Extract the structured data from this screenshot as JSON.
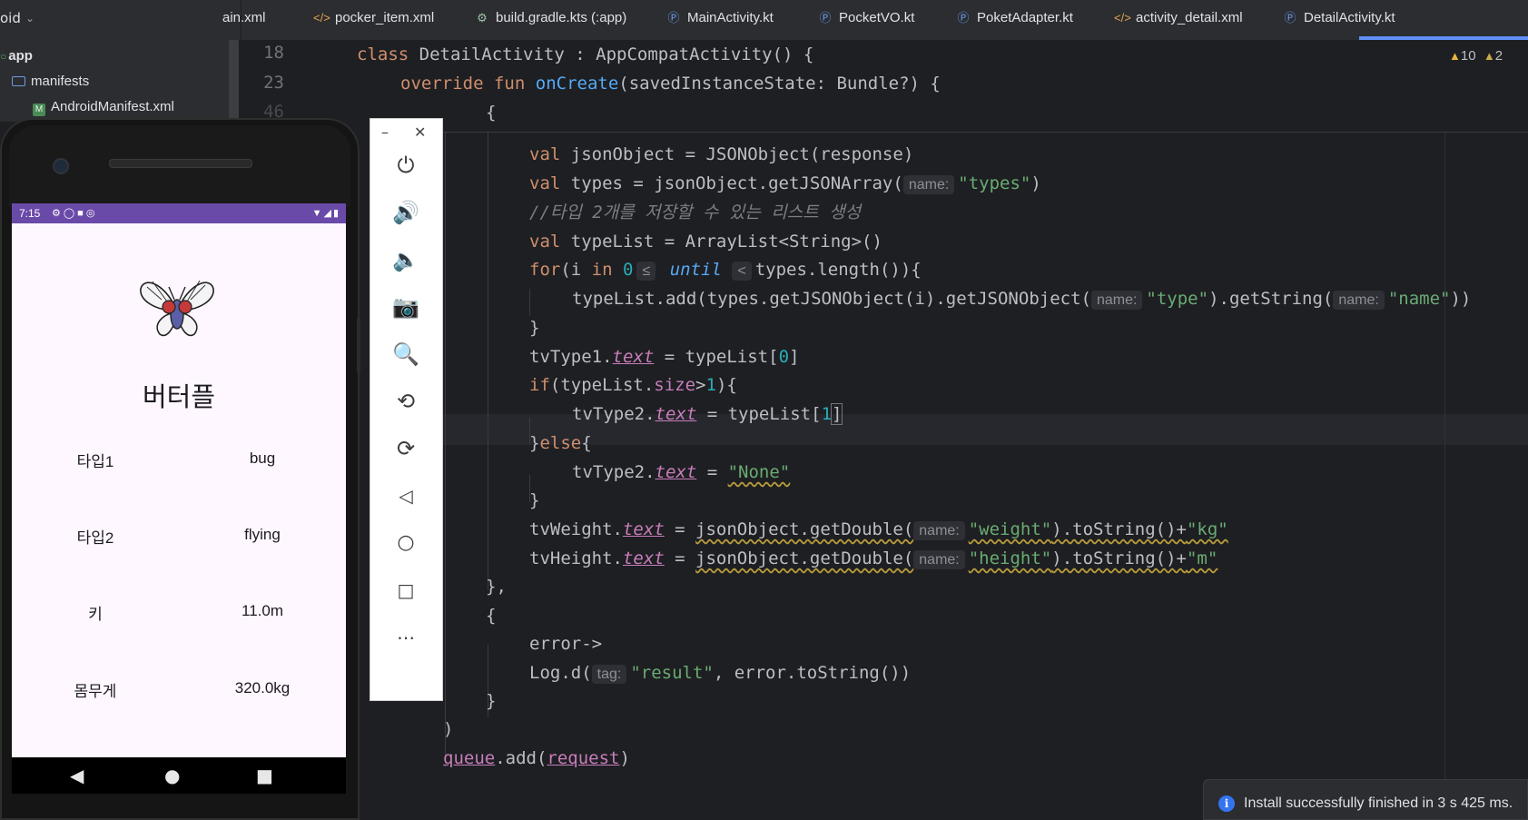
{
  "ide": {
    "project_label": "oid",
    "tabs": [
      {
        "label": "ain.xml",
        "icon": "xml-file-icon"
      },
      {
        "label": "pocker_item.xml",
        "icon": "xml-file-icon"
      },
      {
        "label": "build.gradle.kts (:app)",
        "icon": "gradle-file-icon"
      },
      {
        "label": "MainActivity.kt",
        "icon": "kotlin-class-icon"
      },
      {
        "label": "PocketVO.kt",
        "icon": "kotlin-class-icon"
      },
      {
        "label": "PoketAdapter.kt",
        "icon": "kotlin-class-icon"
      },
      {
        "label": "activity_detail.xml",
        "icon": "xml-file-icon"
      },
      {
        "label": "DetailActivity.kt",
        "icon": "kotlin-class-icon",
        "active": true
      }
    ],
    "tree": {
      "items": [
        "app",
        "manifests",
        "AndroidManifest.xml"
      ]
    },
    "gutter": {
      "lines": [
        "18",
        "23",
        "46"
      ]
    },
    "inspections": {
      "warnings": "10",
      "weak_warnings": "2"
    },
    "code": {
      "sticky1": [
        "class",
        "DetailActivity",
        " : AppCompatActivity() {"
      ],
      "sticky2": [
        "override",
        "fun",
        "onCreate",
        "(savedInstanceState: Bundle?) {"
      ],
      "sticky3": "{",
      "l1": [
        "val",
        " jsonObject = JSONObject(response)"
      ],
      "l2": [
        "val",
        " types = jsonObject.getJSONArray(",
        "name:",
        "\"types\"",
        ")"
      ],
      "l3": "//타입 2개를 저장할 수 있는 리스트 생성",
      "l4": [
        "val",
        " typeList = ArrayList<String>()"
      ],
      "l5": [
        "for",
        "(i ",
        "in",
        "0",
        "≤",
        "until",
        "<",
        "types.length()){"
      ],
      "l6": [
        "typeList.add(types.getJSONObject(i).getJSONObject(",
        "name:",
        "\"type\"",
        ").getString(",
        "name:",
        "\"name\"",
        "))"
      ],
      "l7": "}",
      "l8": [
        "tvType1.",
        "text",
        " = typeList[",
        "0",
        "]"
      ],
      "l9": [
        "if",
        "(typeList.",
        "size",
        ">",
        "1",
        "){"
      ],
      "l10": [
        "tvType2.",
        "text",
        " = typeList[",
        "1",
        "]"
      ],
      "l11": [
        "}",
        "else",
        "{"
      ],
      "l12": [
        "tvType2.",
        "text",
        " = ",
        "\"None\""
      ],
      "l13": "}",
      "l14": [
        "tvWeight.",
        "text",
        " = ",
        "jsonObject.getDouble(",
        "name:",
        "\"weight\"",
        ").toString()+",
        "\"kg\""
      ],
      "l15": [
        "tvHeight.",
        "text",
        " = ",
        "jsonObject.getDouble(",
        "name:",
        "\"height\"",
        ").toString()+",
        "\"m\""
      ],
      "l16": "},",
      "l17": "{",
      "l18": "error->",
      "l19": [
        "Log.d(",
        "tag:",
        "\"result\"",
        ", error.toString())"
      ],
      "l20": "}",
      "l21": ")",
      "l22": [
        "queue",
        ".add(",
        "request",
        ")"
      ]
    },
    "notification": {
      "text": "Install successfully finished in 3 s 425 ms.",
      "icon": "i"
    }
  },
  "phone": {
    "status_time": "7:15",
    "pokemon_name": "버터플",
    "rows": [
      {
        "label": "타입1",
        "value": "bug"
      },
      {
        "label": "타입2",
        "value": "flying"
      },
      {
        "label": "키",
        "value": "11.0m"
      },
      {
        "label": "몸무게",
        "value": "320.0kg"
      }
    ]
  },
  "colors": {
    "status_bar": "#6a4aa8",
    "accent": "#5f8ef5",
    "keyword": "#cf8e6d",
    "string": "#6aab73",
    "number": "#2aacb8",
    "property": "#c77dbb"
  }
}
